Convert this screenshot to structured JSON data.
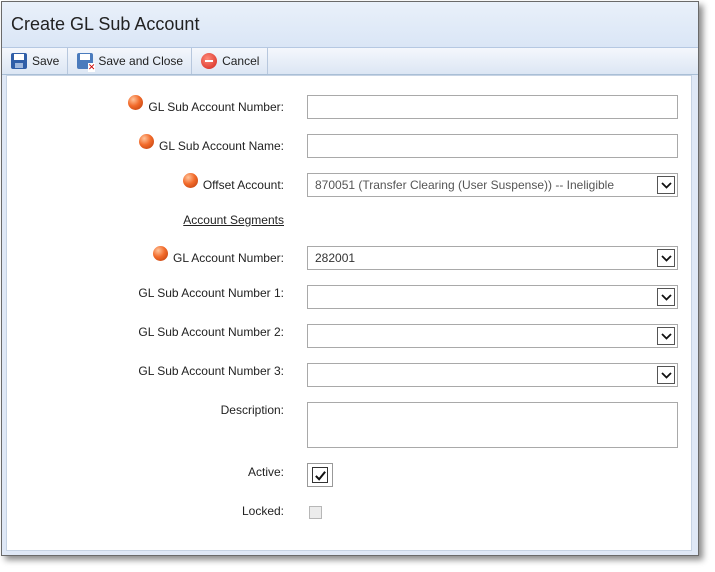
{
  "window": {
    "title": "Create GL Sub Account"
  },
  "toolbar": {
    "save_label": "Save",
    "save_close_label": "Save and Close",
    "cancel_label": "Cancel",
    "save_icon": "floppy-disk-icon",
    "save_close_icon": "floppy-disk-close-icon",
    "cancel_icon": "cancel-circle-icon"
  },
  "form": {
    "sub_account_number": {
      "label": "GL Sub Account Number:",
      "value": "",
      "required": true
    },
    "sub_account_name": {
      "label": "GL Sub Account Name:",
      "value": "",
      "required": true
    },
    "offset_account": {
      "label": "Offset Account:",
      "value": "870051 (Transfer Clearing (User Suspense)) -- Ineligible",
      "required": true
    },
    "segments_heading": "Account Segments",
    "gl_account_number": {
      "label": "GL Account Number:",
      "value": "282001",
      "required": true
    },
    "sub_account_number_1": {
      "label": "GL Sub Account Number 1:",
      "value": ""
    },
    "sub_account_number_2": {
      "label": "GL Sub Account Number 2:",
      "value": ""
    },
    "sub_account_number_3": {
      "label": "GL Sub Account Number 3:",
      "value": ""
    },
    "description": {
      "label": "Description:",
      "value": ""
    },
    "active": {
      "label": "Active:",
      "checked": true
    },
    "locked": {
      "label": "Locked:",
      "checked": false,
      "disabled": true
    }
  },
  "colors": {
    "required_marker": "#f26b2b",
    "header_bg": "#dfe8f6"
  }
}
